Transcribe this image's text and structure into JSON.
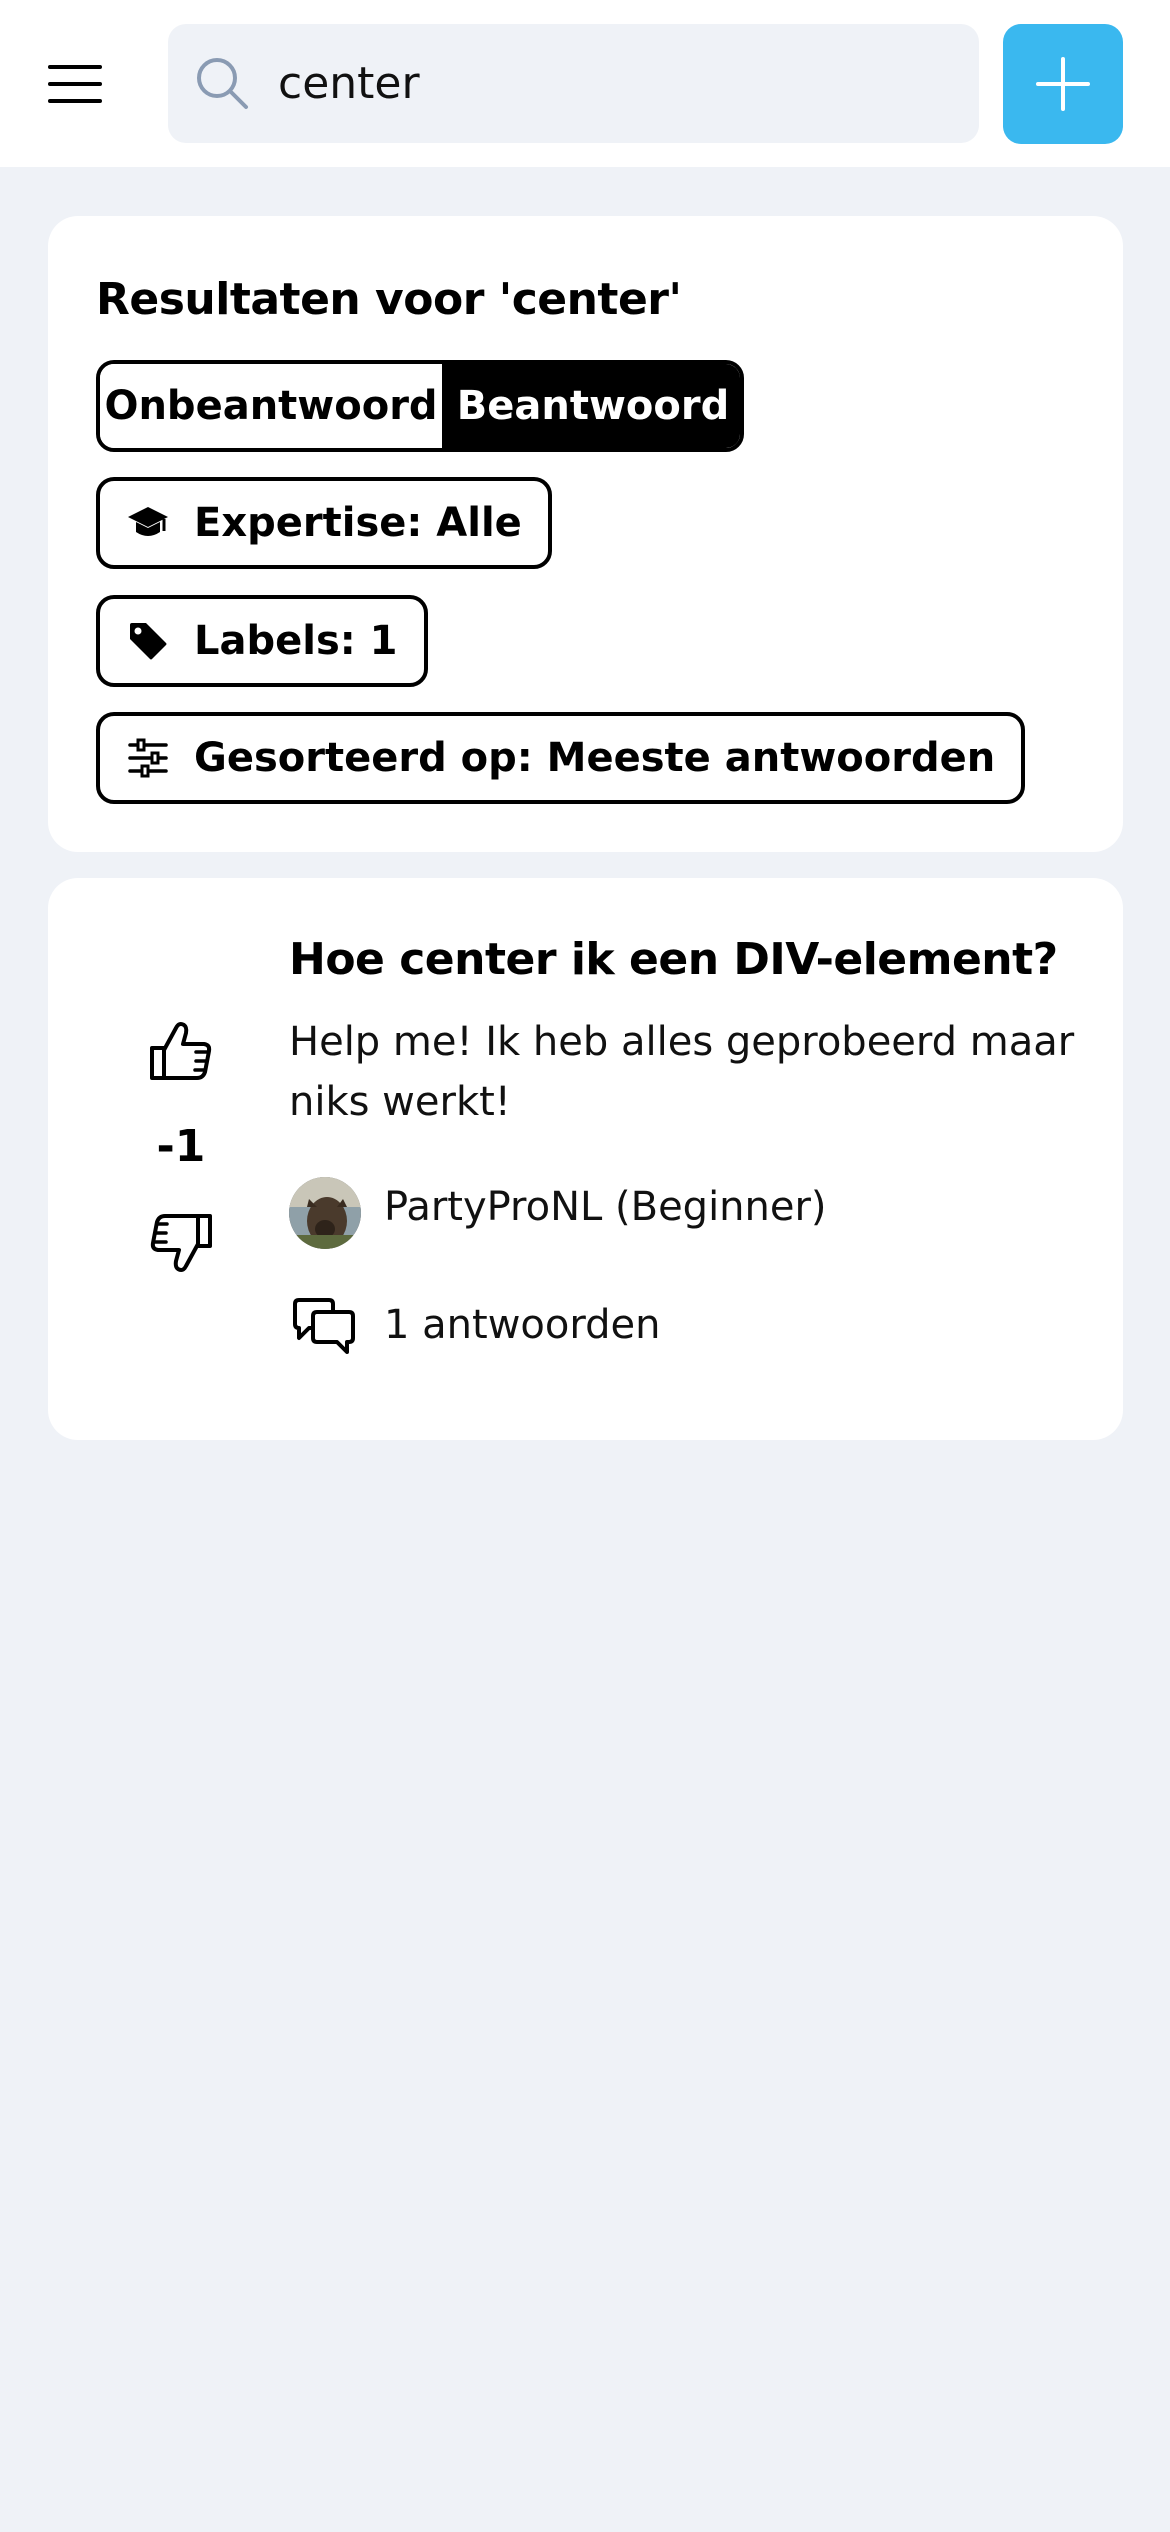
{
  "header": {
    "menu_icon": "hamburger-menu-icon",
    "search": {
      "icon": "search-icon",
      "value": "center"
    },
    "add_icon": "plus-icon",
    "add_color": "#3ab8ef"
  },
  "filters": {
    "title": "Resultaten voor 'center'",
    "status_options": [
      {
        "label": "Onbeantwoord",
        "selected": false
      },
      {
        "label": "Beantwoord",
        "selected": true
      }
    ],
    "expertise": {
      "icon": "graduation-cap-icon",
      "label": "Expertise: Alle"
    },
    "labels": {
      "icon": "tag-icon",
      "label": "Labels: 1"
    },
    "sort": {
      "icon": "sliders-icon",
      "label": "Gesorteerd op: Meeste antwoorden"
    }
  },
  "questions": [
    {
      "votes": "-1",
      "title": "Hoe center ik een DIV-element?",
      "body": "Help me! Ik heb alles geprobeerd maar niks werkt!",
      "author": "PartyProNL (Beginner)",
      "answers": "1 antwoorden"
    }
  ],
  "colors": {
    "background": "#eff2f7",
    "accent": "#3ab8ef"
  }
}
